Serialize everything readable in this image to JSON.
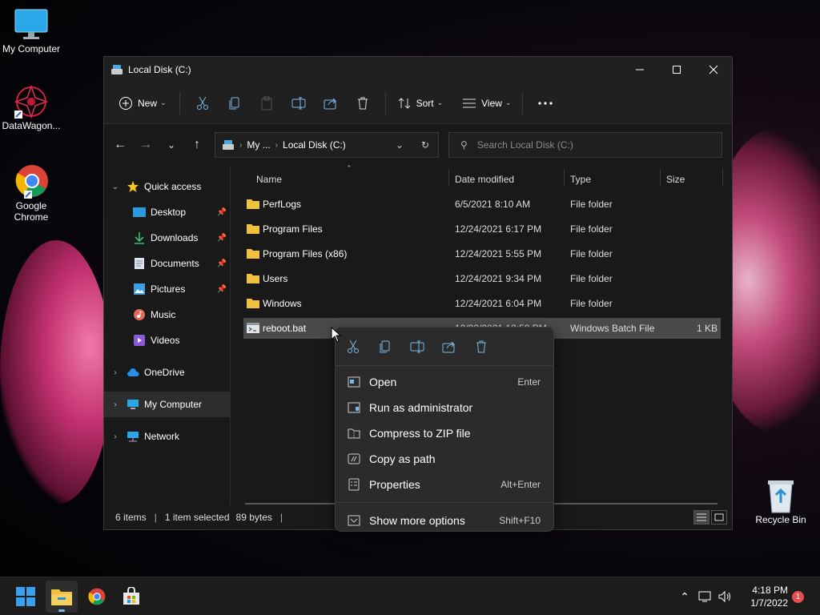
{
  "desktop": {
    "icons": [
      {
        "label": "My Computer"
      },
      {
        "label": "DataWagon..."
      },
      {
        "label": "Google Chrome"
      },
      {
        "label": "Recycle Bin"
      }
    ]
  },
  "window": {
    "title": "Local Disk (C:)",
    "toolbar": {
      "new_label": "New",
      "sort_label": "Sort",
      "view_label": "View"
    },
    "address": {
      "crumbs": [
        "My ...",
        "Local Disk (C:)"
      ]
    },
    "search": {
      "placeholder": "Search Local Disk (C:)"
    },
    "sidebar": {
      "items": [
        {
          "label": "Quick access"
        },
        {
          "label": "Desktop"
        },
        {
          "label": "Downloads"
        },
        {
          "label": "Documents"
        },
        {
          "label": "Pictures"
        },
        {
          "label": "Music"
        },
        {
          "label": "Videos"
        },
        {
          "label": "OneDrive"
        },
        {
          "label": "My Computer"
        },
        {
          "label": "Network"
        }
      ]
    },
    "columns": {
      "name": "Name",
      "date": "Date modified",
      "type": "Type",
      "size": "Size"
    },
    "files": [
      {
        "name": "PerfLogs",
        "date": "6/5/2021 8:10 AM",
        "type": "File folder",
        "size": ""
      },
      {
        "name": "Program Files",
        "date": "12/24/2021 6:17 PM",
        "type": "File folder",
        "size": ""
      },
      {
        "name": "Program Files (x86)",
        "date": "12/24/2021 5:55 PM",
        "type": "File folder",
        "size": ""
      },
      {
        "name": "Users",
        "date": "12/24/2021 9:34 PM",
        "type": "File folder",
        "size": ""
      },
      {
        "name": "Windows",
        "date": "12/24/2021 6:04 PM",
        "type": "File folder",
        "size": ""
      },
      {
        "name": "reboot.bat",
        "date": "12/22/2021 12:58 PM",
        "type": "Windows Batch File",
        "size": "1 KB"
      }
    ],
    "status": {
      "items": "6 items",
      "selected": "1 item selected",
      "bytes": "89 bytes"
    }
  },
  "context_menu": {
    "items": [
      {
        "label": "Open",
        "key": "Enter"
      },
      {
        "label": "Run as administrator",
        "key": ""
      },
      {
        "label": "Compress to ZIP file",
        "key": ""
      },
      {
        "label": "Copy as path",
        "key": ""
      },
      {
        "label": "Properties",
        "key": "Alt+Enter"
      },
      {
        "label": "Show more options",
        "key": "Shift+F10"
      }
    ]
  },
  "taskbar": {
    "time": "4:18 PM",
    "date": "1/7/2022",
    "notifications": "1"
  },
  "colors": {
    "accent": "#76b9ed",
    "folder": "#f0c040",
    "notification": "#e84c4c"
  }
}
